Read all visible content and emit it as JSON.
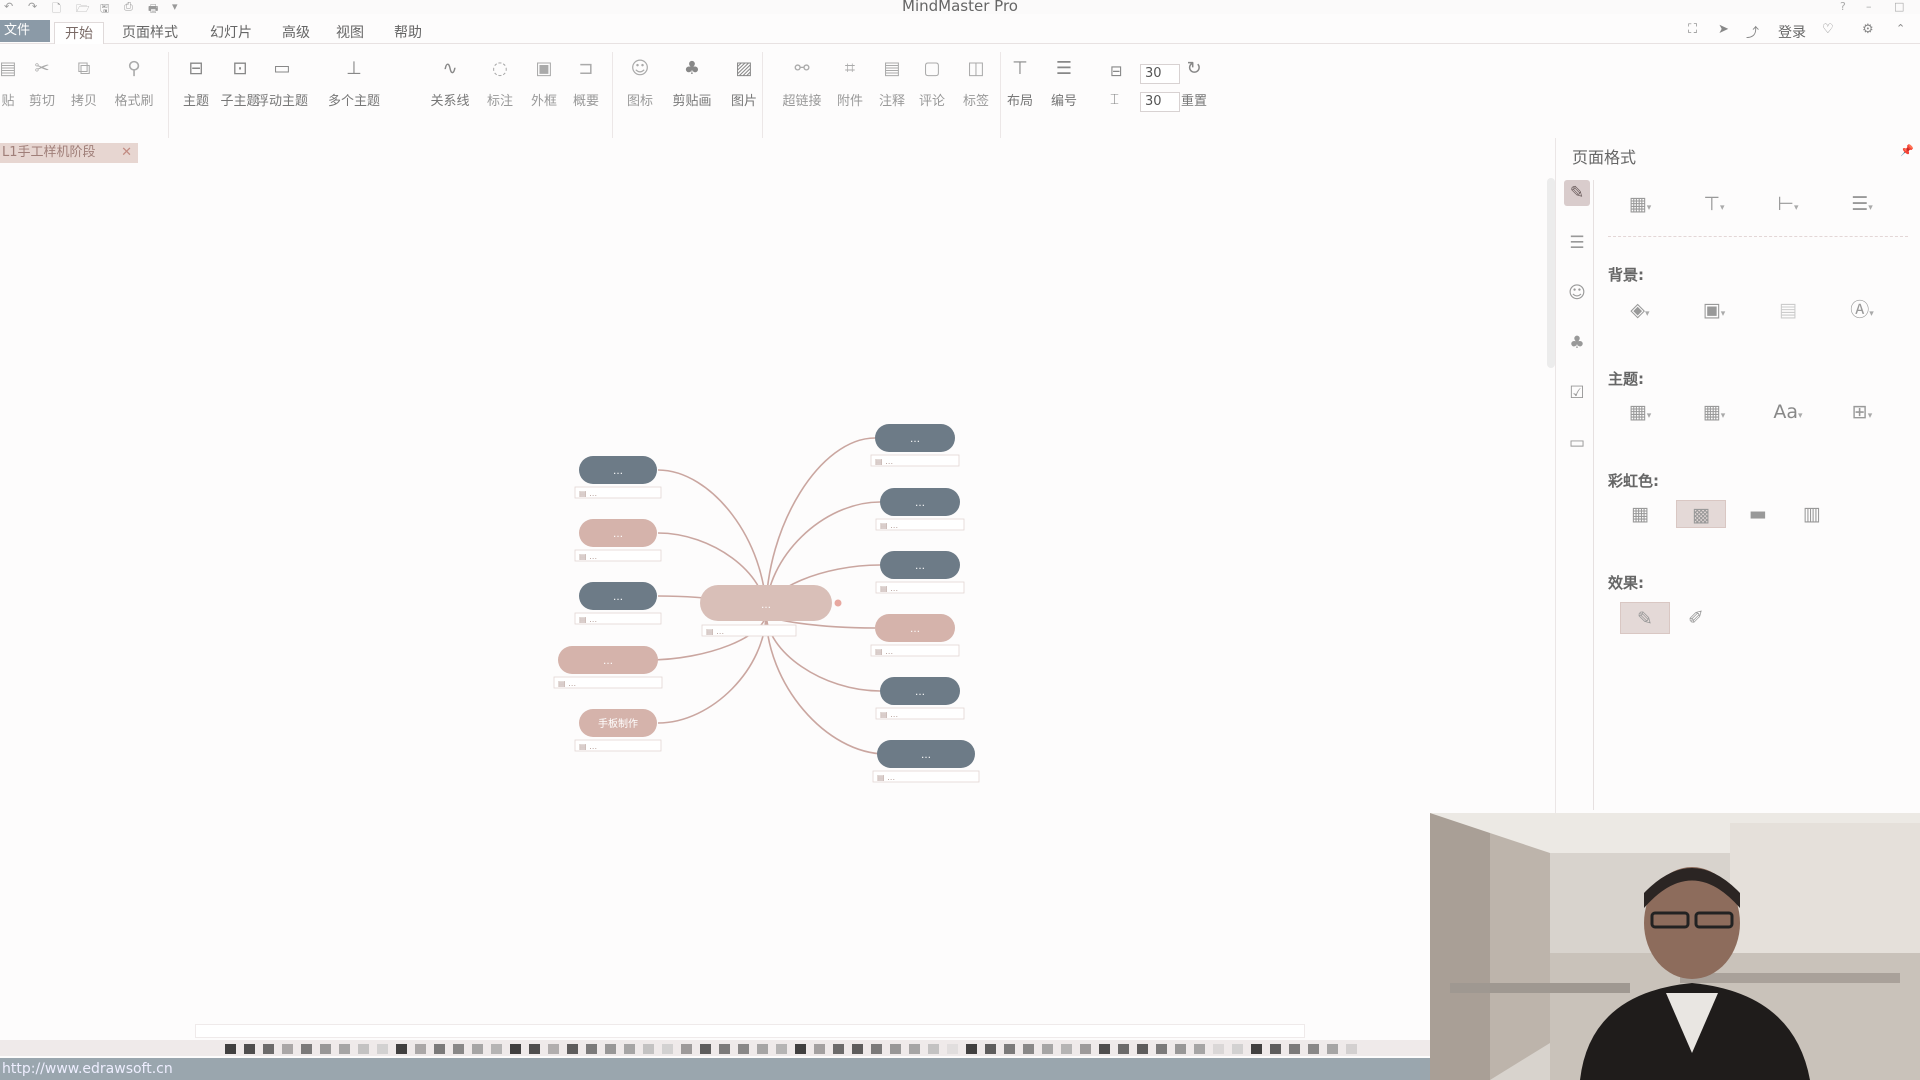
{
  "titlebar": {
    "title": "MindMaster Pro",
    "quick_access": [
      "↶",
      "↷",
      "🗋",
      "🗁",
      "🖫",
      "⎙",
      "🖶",
      "▾"
    ],
    "window_controls": [
      "?",
      "–",
      "□"
    ]
  },
  "menu": {
    "file": "文件",
    "tabs": [
      "开始",
      "页面样式",
      "幻灯片",
      "高级",
      "视图",
      "帮助"
    ],
    "active_tab": "开始",
    "right_items": [
      "登录"
    ]
  },
  "ribbon": {
    "buttons": [
      {
        "label": "贴",
        "icon": "paste-icon"
      },
      {
        "label": "剪切",
        "icon": "cut-icon"
      },
      {
        "label": "拷贝",
        "icon": "copy-icon"
      },
      {
        "label": "格式刷",
        "icon": "format-painter-icon"
      },
      {
        "label": "主题",
        "icon": "topic-icon"
      },
      {
        "label": "子主题",
        "icon": "subtopic-icon"
      },
      {
        "label": "浮动主题",
        "icon": "floating-topic-icon"
      },
      {
        "label": "多个主题",
        "icon": "multiple-topics-icon"
      },
      {
        "label": "关系线",
        "icon": "relationship-icon"
      },
      {
        "label": "标注",
        "icon": "callout-icon"
      },
      {
        "label": "外框",
        "icon": "boundary-icon"
      },
      {
        "label": "概要",
        "icon": "summary-icon"
      },
      {
        "label": "图标",
        "icon": "marker-icon"
      },
      {
        "label": "剪贴画",
        "icon": "clipart-icon"
      },
      {
        "label": "图片",
        "icon": "picture-icon"
      },
      {
        "label": "超链接",
        "icon": "hyperlink-icon"
      },
      {
        "label": "附件",
        "icon": "attachment-icon"
      },
      {
        "label": "注释",
        "icon": "note-icon"
      },
      {
        "label": "评论",
        "icon": "comment-icon"
      },
      {
        "label": "标签",
        "icon": "tag-icon"
      },
      {
        "label": "布局",
        "icon": "layout-icon"
      },
      {
        "label": "编号",
        "icon": "numbering-icon"
      },
      {
        "label": "重置",
        "icon": "reset-icon"
      }
    ],
    "spacing_h": "30",
    "spacing_v": "30"
  },
  "document_tab": {
    "label": "L1手工样机阶段",
    "close": "✕"
  },
  "mindmap": {
    "central": {
      "text": "…",
      "meta": "▤ …"
    },
    "left_topics": [
      {
        "text": "…",
        "meta": "▤ …",
        "color": "#6d7b87"
      },
      {
        "text": "…",
        "meta": "▤ …",
        "color": "#d5b3ab"
      },
      {
        "text": "…",
        "meta": "▤ …",
        "color": "#6d7b87"
      },
      {
        "text": "…",
        "meta": "▤ …",
        "color": "#d5b3ab"
      },
      {
        "text": "手板制作",
        "meta": "▤ …",
        "color": "#d5b3ab"
      }
    ],
    "right_topics": [
      {
        "text": "…",
        "meta": "▤ …",
        "color": "#6d7b87"
      },
      {
        "text": "…",
        "meta": "▤ …",
        "color": "#6d7b87"
      },
      {
        "text": "…",
        "meta": "▤ …",
        "color": "#6d7b87"
      },
      {
        "text": "…",
        "meta": "▤ …",
        "color": "#d5b3ab"
      },
      {
        "text": "…",
        "meta": "▤ …",
        "color": "#6d7b87"
      },
      {
        "text": "…",
        "meta": "▤ …",
        "color": "#6d7b87"
      }
    ],
    "branch_color": "#caa6a0",
    "central_color": "#d9bfb8"
  },
  "right_panel": {
    "title": "页面格式",
    "sections": {
      "background": "背景:",
      "theme": "主题:",
      "rainbow": "彩虹色:",
      "effect": "效果:"
    },
    "font_sample": "Aa",
    "rainbow_selected": 1,
    "effect_selected": 0
  },
  "status": {
    "url": "http://www.edrawsoft.cn",
    "zoom": "…"
  },
  "colors": {
    "accent_blue": "#6d7b87",
    "accent_pink": "#d5b3ab",
    "panel_select": "#e4d9d7"
  }
}
